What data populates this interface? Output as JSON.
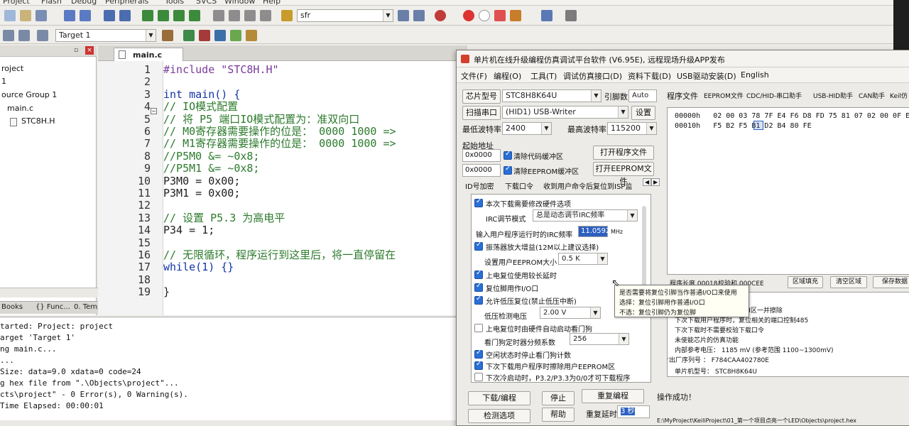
{
  "ide": {
    "menu": [
      "Project",
      "Flash",
      "Debug",
      "Peripherals",
      "Tools",
      "SVCS",
      "Window",
      "Help"
    ],
    "find_combo": "sfr",
    "target_combo": "Target 1",
    "project_tree": {
      "items": [
        "roject",
        "1",
        "ource Group 1",
        "main.c",
        "STC8H.H"
      ]
    },
    "project_tabs": [
      "Books",
      "{} Func...",
      "0. Temp..."
    ],
    "editor": {
      "tab_label": "main.c",
      "line_numbers": [
        "1",
        "2",
        "3",
        "4",
        "5",
        "6",
        "7",
        "8",
        "9",
        "10",
        "11",
        "12",
        "13",
        "14",
        "15",
        "16",
        "17",
        "18",
        "19"
      ],
      "lines": [
        "#include \"STC8H.H\"",
        "",
        "int main() {",
        "  // IO模式配置",
        "    // 将 P5 端口IO模式配置为：准双向口",
        "    // M0寄存器需要操作的位是： 0000 1000  =>",
        "    // M1寄存器需要操作的位是： 0000 1000  =>",
        "    //P5M0 &= ~0x8;",
        "    //P5M1 &= ~0x8;",
        "    P3M0 = 0x00;",
        "    P3M1 = 0x00;",
        "",
        "    // 设置 P5.3 为高电平",
        "    P34 = 1;",
        "",
        "    // 无限循环，程序运行到这里后，将一直停留在",
        "    while(1) {}",
        "",
        "}"
      ]
    },
    "build_output": [
      "tarted: Project: project",
      "arget 'Target 1'",
      "ng main.c...",
      "...",
      " Size: data=9.0 xdata=0 code=24",
      "g hex file from \".\\Objects\\project\"...",
      "cts\\project\" - 0 Error(s), 0 Warning(s).",
      "Time Elapsed:  00:00:01"
    ]
  },
  "stc": {
    "title": "单片机在线升级编程仿真调试平台软件 (V6.95E), 远程现场升级APP发布",
    "menu": [
      "文件(F)",
      "编程(O)",
      "工具(T)",
      "调试仿真接口(D)",
      "资料下载(D)",
      "USB驱动安装(D)",
      "English"
    ],
    "chip_btn": "芯片型号",
    "chip_value": "STC8H8K64U",
    "pin_label": "引脚数",
    "pin_value": "Auto",
    "scan_btn": "扫描串口",
    "port_value": "(HID1) USB-Writer",
    "settings_btn": "设置",
    "min_baud_label": "最低波特率",
    "min_baud_value": "2400",
    "max_baud_label": "最高波特率",
    "max_baud_value": "115200",
    "start_addr_label": "起始地址",
    "addr1": "0x0000",
    "addr2": "0x0000",
    "clear_code": "清除代码缓冲区",
    "clear_eeprom": "清除EEPROM缓冲区",
    "open_prog_btn": "打开程序文件",
    "open_eeprom_btn": "打开EEPROM文件",
    "sub_tabs": [
      "ID号加密",
      "下载口令",
      "收到用户命令后复位到ISP监"
    ],
    "options": {
      "o1": "本次下载需要修改硬件选项",
      "irc_mode_label": "IRC调节模式",
      "irc_mode_value": "总是动态调节IRC频率",
      "freq_label": "输入用户程序运行时的IRC频率",
      "freq_value": "11.0592",
      "freq_unit": "MHz",
      "o2": "振荡器放大增益(12M以上建议选择)",
      "eeprom_size_label": "设置用户EEPROM大小",
      "eeprom_size_value": "0.5 K",
      "o3": "上电复位使用较长延时",
      "o4": "复位脚用作I/O口",
      "o5": "允许低压复位(禁止低压中断)",
      "lv_label": "低压检测电压",
      "lv_value": "2.00 V",
      "o6": "上电复位时由硬件自动启动看门狗",
      "wdt_label": "看门狗定时器分频系数",
      "wdt_value": "256",
      "o7": "空闲状态时停止看门狗计数",
      "o8": "下次下载用户程序时擦除用户EEPROM区",
      "o9": "下次冷启动时，P3.2/P3.3为0/0才可下载程序"
    },
    "download_btn": "下载/编程",
    "stop_btn": "停止",
    "reprogram_btn": "重复编程",
    "check_btn": "检测选项",
    "help_btn": "帮助",
    "repeat_delay_label": "重复延时",
    "repeat_delay_value": "3 秒",
    "right_tabs": [
      "程序文件",
      "EEPROM文件",
      "CDC/HID-串口助手",
      "USB-HID助手",
      "CAN助手",
      "Keil仿"
    ],
    "hex_rows": [
      {
        "addr": "00000h",
        "bytes": "02 00 03 78 7F E4 F6 D8 FD 75 81 07 02 00 0F E4"
      },
      {
        "addr": "00010h",
        "bytes": "F5 B2 F5 B1 D2 B4 80 FE"
      }
    ],
    "hex_selected": "B1",
    "hex_toolbar": [
      "程序长度 00018",
      "校验和 000CEE",
      "区域填充",
      "清空区域",
      "保存数据"
    ],
    "tooltip": [
      "是否需要将复位引脚当作普通I/O口来使用",
      "选择：复位引脚用作普通I/O口",
      "不选：复位引脚仍为复位脚"
    ],
    "info_lines": [
      "户EEPROM区一并擦除",
      "下次下载用户程序时，复位相关的端口控制485",
      "下次下载时不需要校验下载口令",
      "未使能芯片的仿真功能",
      "内部参考电压： 1185 mV (参考范围  1100~1300mV)",
      "芯片出厂序列号 ： F784CAA402780E",
      "单片机型号： STC8H8K64U"
    ],
    "status": "操作成功！",
    "path": "E:\\MyProject\\KeiliProject\\01_第一个项目点亮一个LED\\Objects\\project.hex"
  }
}
